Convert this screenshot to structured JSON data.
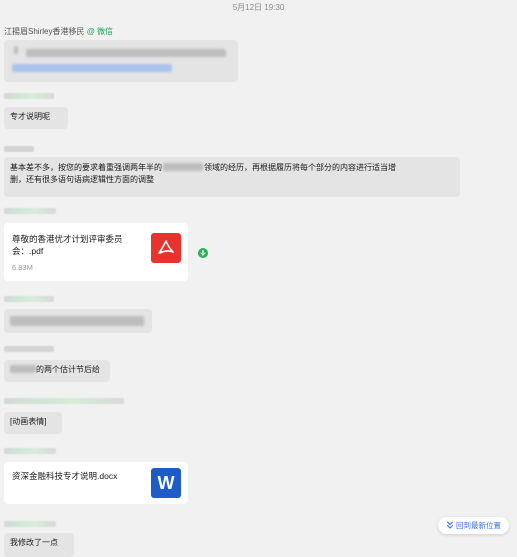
{
  "timestamp": "5月12日 19:30",
  "first_sender": {
    "name": "江揚眉Shirley香港移民",
    "source": "@ 微信"
  },
  "messages": {
    "m2": "专才说明呢",
    "m3_a": "基本差不多，按您的要求着重强调两年半的",
    "m3_b": "领域的经历，再根据履历将每个部分的内容进行适当增",
    "m3_c": "删，还有很多语句语病逻辑性方面的调整",
    "m5": "的两个估计节后给",
    "m6": "[动画表情]",
    "m8": "我修改了一点"
  },
  "files": {
    "pdf": {
      "name_line1": "尊敬的香港优才计划评审委员",
      "name_line2": "会：.pdf",
      "size": "6.83M",
      "icon": "pdf-icon"
    },
    "word": {
      "name": "资深金融科技专才说明.docx",
      "icon": "word-icon",
      "letter": "W"
    }
  },
  "controls": {
    "back_to_latest": "回到最新位置",
    "back_icon": "double-chevron-down-icon",
    "download_icon": "download-arrow-icon"
  },
  "colors": {
    "background": "#f1f1f1",
    "bubble": "#e4e4e4",
    "wechat_green": "#19a15a",
    "pdf_red": "#e8322e",
    "word_blue": "#1e5bc6",
    "link_blue": "#3a72e0"
  }
}
